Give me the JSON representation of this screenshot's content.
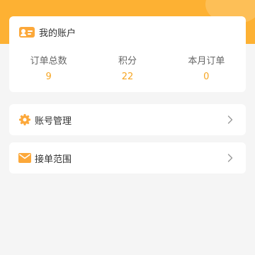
{
  "account": {
    "title": "我的账户",
    "icon": "id-card-icon",
    "stats": [
      {
        "label": "订单总数",
        "value": "9"
      },
      {
        "label": "积分",
        "value": "22"
      },
      {
        "label": "本月订单",
        "value": "0"
      }
    ]
  },
  "menu": [
    {
      "label": "账号管理",
      "icon": "gear-icon"
    },
    {
      "label": "接单范围",
      "icon": "envelope-icon"
    }
  ],
  "colors": {
    "header": "#fdb133",
    "accent": "#f6a623",
    "background": "#f5f5f5"
  }
}
